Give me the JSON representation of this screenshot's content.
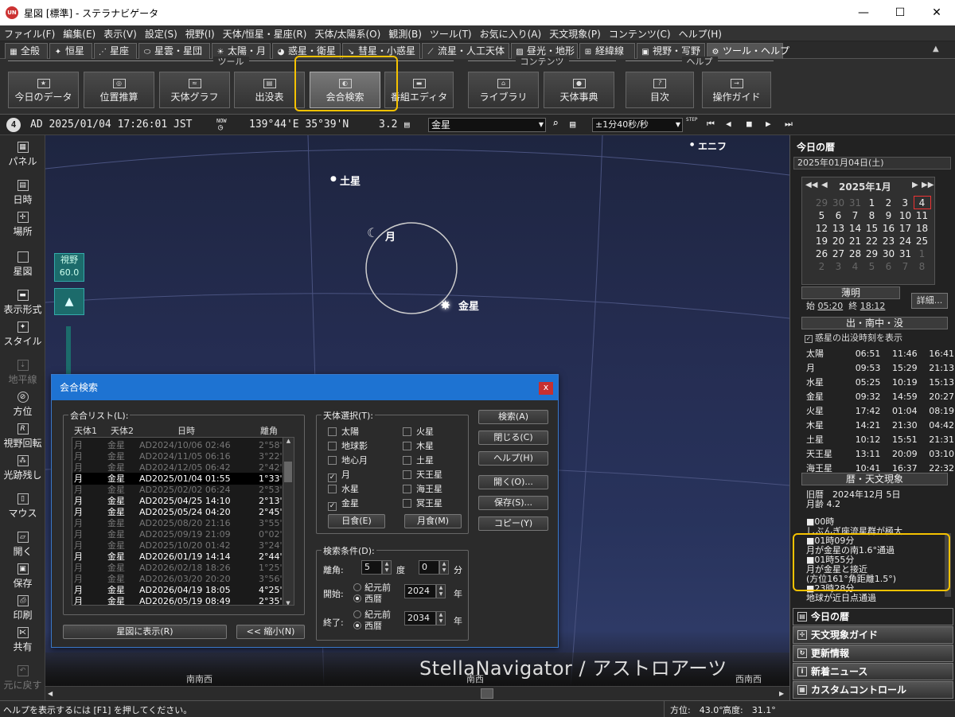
{
  "window": {
    "title": "星図 [標準] - ステラナビゲータ",
    "app_icon": "UN"
  },
  "menu": [
    "ファイル(F)",
    "編集(E)",
    "表示(V)",
    "設定(S)",
    "視野(I)",
    "天体/恒星・星座(R)",
    "天体/太陽系(O)",
    "観測(B)",
    "ツール(T)",
    "お気に入り(A)",
    "天文現象(P)",
    "コンテンツ(C)",
    "ヘルプ(H)"
  ],
  "tabs": [
    "全般",
    "恒星",
    "星座",
    "星雲・星団",
    "太陽・月",
    "惑星・衛星",
    "彗星・小惑星",
    "流星・人工天体",
    "昼光・地形",
    "経緯線",
    "視野・写野",
    "ツール・ヘルプ"
  ],
  "ribbon": {
    "groups": [
      "ツール",
      "コンテンツ",
      "ヘルプ"
    ],
    "buttons": [
      "今日のデータ",
      "位置推算",
      "天体グラフ",
      "出没表",
      "会合検索",
      "番組エディタ",
      "ライブラリ",
      "天体事典",
      "目次",
      "操作ガイド"
    ]
  },
  "toolbar": {
    "badge": "4",
    "datetime": "AD 2025/01/04 17:26:01 JST",
    "now_label": "NOW",
    "location": "139°44'E 35°39'N",
    "magnitude": "3.2",
    "target": "金星",
    "step": "±1分40秒/秒",
    "step_label": "STEP"
  },
  "leftbar": [
    "パネル",
    "日時",
    "場所",
    "星図",
    "表示形式",
    "スタイル",
    "地平線",
    "方位",
    "視野回転",
    "光跡残し",
    "マウス",
    "開く",
    "保存",
    "印刷",
    "共有",
    "元に戻す"
  ],
  "sky": {
    "labels": {
      "saturn": "土星",
      "moon": "月",
      "venus": "金星",
      "enif": "エニフ"
    },
    "fov_label": "視野",
    "fov_value": "60.0",
    "watermark": "StellaNavigator / アストロアーツ",
    "compass": [
      "南南西",
      "南西",
      "西南西"
    ]
  },
  "right_panel": {
    "header": "今日の暦",
    "date": "2025年01月04日(土)",
    "cal_title": "2025年1月",
    "weeks": [
      [
        "29",
        "30",
        "31",
        "1",
        "2",
        "3",
        "4"
      ],
      [
        "5",
        "6",
        "7",
        "8",
        "9",
        "10",
        "11"
      ],
      [
        "12",
        "13",
        "14",
        "15",
        "16",
        "17",
        "18"
      ],
      [
        "19",
        "20",
        "21",
        "22",
        "23",
        "24",
        "25"
      ],
      [
        "26",
        "27",
        "28",
        "29",
        "30",
        "31",
        "1"
      ],
      [
        "2",
        "3",
        "4",
        "5",
        "6",
        "7",
        "8"
      ]
    ],
    "twilight_title": "薄明",
    "twilight_start_label": "始",
    "twilight_start": "05:20",
    "twilight_end_label": "終",
    "twilight_end": "18:12",
    "detail_btn": "詳細...",
    "rise_title": "出・南中・没",
    "planet_checkbox": "惑星の出没時刻を表示",
    "rise_rows": [
      [
        "太陽",
        "06:51",
        "11:46",
        "16:41"
      ],
      [
        "月",
        "09:53",
        "15:29",
        "21:13"
      ],
      [
        "水星",
        "05:25",
        "10:19",
        "15:13"
      ],
      [
        "金星",
        "09:32",
        "14:59",
        "20:27"
      ],
      [
        "火星",
        "17:42",
        "01:04",
        "08:19"
      ],
      [
        "木星",
        "14:21",
        "21:30",
        "04:42"
      ],
      [
        "土星",
        "10:12",
        "15:51",
        "21:31"
      ],
      [
        "天王星",
        "13:11",
        "20:09",
        "03:10"
      ],
      [
        "海王星",
        "10:41",
        "16:37",
        "22:32"
      ]
    ],
    "events_title": "暦・天文現象",
    "lunar_date": "旧暦　2024年12月 5日",
    "moon_age": "月齢 4.2",
    "events": [
      "■00時",
      "しぶんぎ座流星群が極大",
      "■01時09分",
      "月が金星の南1.6°通過",
      "■01時55分",
      "月が金星と接近",
      "(方位161°角距離1.5°)",
      "■23時28分",
      "地球が近日点通過"
    ],
    "nav": [
      "今日の暦",
      "天文現象ガイド",
      "更新情報",
      "新着ニュース",
      "カスタムコントロール"
    ]
  },
  "status": {
    "help": "ヘルプを表示するには [F1] を押してください。",
    "azimuth": "方位:　43.0°",
    "altitude": "高度:　31.1°"
  },
  "dialog": {
    "title": "会合検索",
    "close": "x",
    "list_label": "会合リスト(L):",
    "headers": [
      "天体1",
      "天体2",
      "日時",
      "離角"
    ],
    "rows": [
      {
        "b1": "月",
        "b2": "金星",
        "dt": "AD2024/10/06  02:46",
        "sep": "2°58'",
        "state": "dim"
      },
      {
        "b1": "月",
        "b2": "金星",
        "dt": "AD2024/11/05  06:16",
        "sep": "3°22'",
        "state": "dim"
      },
      {
        "b1": "月",
        "b2": "金星",
        "dt": "AD2024/12/05  06:42",
        "sep": "2°42'",
        "state": "dim"
      },
      {
        "b1": "月",
        "b2": "金星",
        "dt": "AD2025/01/04  01:55",
        "sep": "1°33'",
        "state": "sel"
      },
      {
        "b1": "月",
        "b2": "金星",
        "dt": "AD2025/02/02  06:24",
        "sep": "2°53'",
        "state": "dim"
      },
      {
        "b1": "月",
        "b2": "金星",
        "dt": "AD2025/04/25  14:10",
        "sep": "2°13'",
        "state": "hi"
      },
      {
        "b1": "月",
        "b2": "金星",
        "dt": "AD2025/05/24  04:20",
        "sep": "2°45'",
        "state": "hi"
      },
      {
        "b1": "月",
        "b2": "金星",
        "dt": "AD2025/08/20  21:16",
        "sep": "3°55'",
        "state": "dim"
      },
      {
        "b1": "月",
        "b2": "金星",
        "dt": "AD2025/09/19  21:09",
        "sep": "0°02'",
        "state": "dim"
      },
      {
        "b1": "月",
        "b2": "金星",
        "dt": "AD2025/10/20  01:42",
        "sep": "3°24'",
        "state": "dim"
      },
      {
        "b1": "月",
        "b2": "金星",
        "dt": "AD2026/01/19  14:14",
        "sep": "2°44'",
        "state": "hi"
      },
      {
        "b1": "月",
        "b2": "金星",
        "dt": "AD2026/02/18  18:26",
        "sep": "1°25'",
        "state": "dim"
      },
      {
        "b1": "月",
        "b2": "金星",
        "dt": "AD2026/03/20  20:20",
        "sep": "3°56'",
        "state": "dim"
      },
      {
        "b1": "月",
        "b2": "金星",
        "dt": "AD2026/04/19  18:05",
        "sep": "4°25'",
        "state": "hi"
      },
      {
        "b1": "月",
        "b2": "金星",
        "dt": "AD2026/05/19  08:49",
        "sep": "2°35'",
        "state": "hi"
      }
    ],
    "show_btn": "星図に表示(R)",
    "shrink_btn": "<< 縮小(N)",
    "body_label": "天体選択(T):",
    "bodies_left": [
      {
        "name": "太陽",
        "checked": false
      },
      {
        "name": "地球影",
        "checked": false
      },
      {
        "name": "地心月",
        "checked": false
      },
      {
        "name": "月",
        "checked": true
      },
      {
        "name": "水星",
        "checked": false
      },
      {
        "name": "金星",
        "checked": true
      }
    ],
    "bodies_right": [
      {
        "name": "火星",
        "checked": false
      },
      {
        "name": "木星",
        "checked": false
      },
      {
        "name": "土星",
        "checked": false
      },
      {
        "name": "天王星",
        "checked": false
      },
      {
        "name": "海王星",
        "checked": false
      },
      {
        "name": "冥王星",
        "checked": false
      }
    ],
    "solar_eclipse": "日食(E)",
    "lunar_eclipse": "月食(M)",
    "cond_label": "検索条件(D):",
    "sep_label": "離角:",
    "sep_deg": "5",
    "deg_unit": "度",
    "sep_min": "0",
    "min_unit": "分",
    "start_label": "開始:",
    "end_label": "終了:",
    "bc_label": "紀元前",
    "ad_label": "西暦",
    "start_year": "2024",
    "end_year": "2034",
    "year_unit": "年",
    "buttons": [
      "検索(A)",
      "閉じる(C)",
      "ヘルプ(H)",
      "開く(O)...",
      "保存(S)...",
      "コピー(Y)"
    ]
  }
}
